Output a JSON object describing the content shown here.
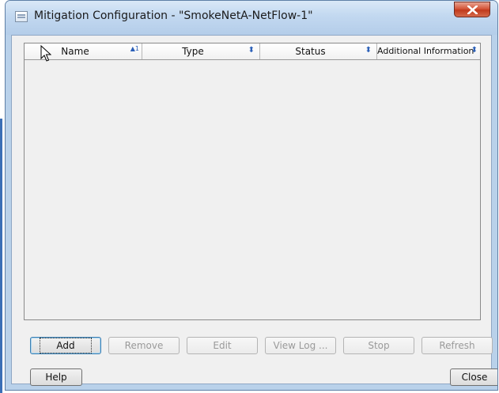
{
  "window": {
    "title": "Mitigation Configuration - \"SmokeNetA-NetFlow-1\"",
    "icon": "dialog-icon",
    "close_icon": "close-x-icon"
  },
  "table": {
    "columns": [
      {
        "label": "Name",
        "sort": "ascending",
        "sort_indicator": "▲1"
      },
      {
        "label": "Type",
        "sort": "none",
        "sort_indicator": "⬍"
      },
      {
        "label": "Status",
        "sort": "none",
        "sort_indicator": "⬍"
      },
      {
        "label": "Additional Information",
        "sort": "none",
        "sort_indicator": "⬍"
      }
    ],
    "rows": []
  },
  "actions": {
    "add": "Add",
    "remove": "Remove",
    "edit": "Edit",
    "view_log": "View Log ...",
    "stop": "Stop",
    "refresh": "Refresh"
  },
  "footer": {
    "help": "Help",
    "close": "Close"
  },
  "colors": {
    "frame": "#b9d1ea",
    "client_bg": "#f0f0f0",
    "close_button": "#c8462a",
    "sort_icon": "#2a5fb8"
  }
}
